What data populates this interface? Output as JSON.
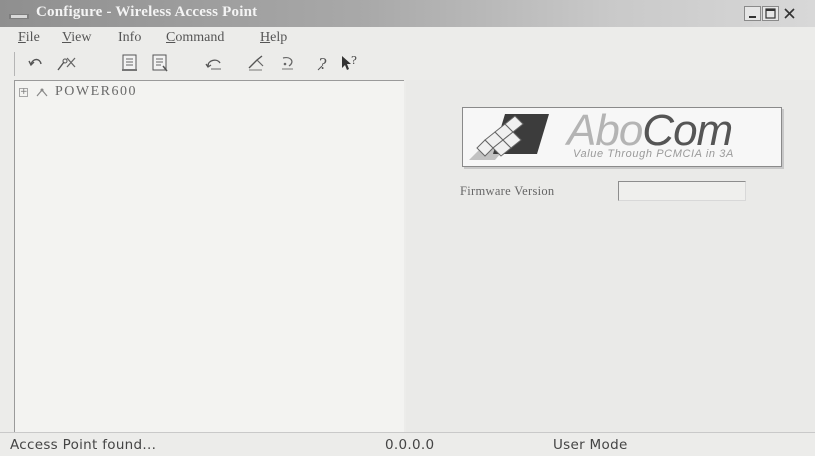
{
  "window": {
    "title": "Configure - Wireless Access Point"
  },
  "menu": {
    "items": [
      {
        "mnemonic": "F",
        "rest": "ile"
      },
      {
        "mnemonic": "V",
        "rest": "iew"
      },
      {
        "mnemonic": "",
        "rest": "Info"
      },
      {
        "mnemonic": "C",
        "rest": "ommand"
      },
      {
        "mnemonic": "H",
        "rest": "elp"
      }
    ]
  },
  "toolbar": {
    "buttons": [
      "undo-icon",
      "wireless-disconnect-icon",
      "document-icon",
      "document-list-icon",
      "refresh-icon",
      "apply-settings-icon",
      "reset-icon",
      "help-icon",
      "context-help-icon"
    ]
  },
  "tree": {
    "root_label": "POWER600",
    "expander": "+"
  },
  "logo": {
    "brand_prefix": "Abo",
    "brand_suffix": "Com",
    "tagline": "Value Through PCMCIA in 3A"
  },
  "firmware": {
    "label": "Firmware Version",
    "value": ""
  },
  "status": {
    "message": "Access Point found...",
    "ip": "0.0.0.0",
    "mode": "User Mode"
  },
  "colors": {
    "titlebar_start": "#8f8f8f",
    "titlebar_end": "#d8d8d8",
    "window_bg": "#ececea"
  }
}
